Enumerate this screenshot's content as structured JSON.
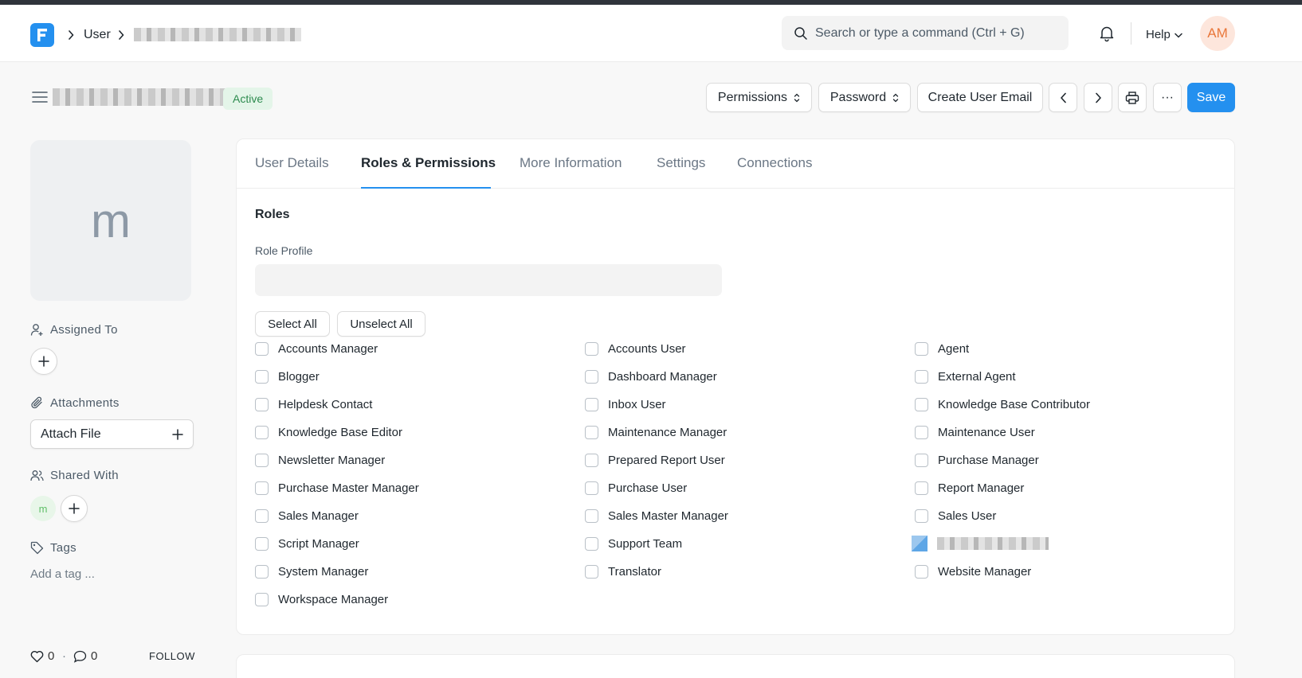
{
  "navbar": {
    "logo_letter": "F",
    "breadcrumb_doctype": "User",
    "search_placeholder": "Search or type a command (Ctrl + G)",
    "help_label": "Help",
    "user_initials": "AM"
  },
  "header": {
    "status": "Active",
    "buttons": {
      "permissions": "Permissions",
      "password": "Password",
      "create_user_email": "Create User Email",
      "more": "···",
      "save": "Save"
    }
  },
  "sidebar": {
    "avatar_letter": "m",
    "assigned_to": "Assigned To",
    "attachments": "Attachments",
    "attach_file": "Attach File",
    "shared_with": "Shared With",
    "shared_avatar": "m",
    "tags": "Tags",
    "add_tag": "Add a tag ...",
    "likes": "0",
    "comments": "0",
    "follow": "FOLLOW"
  },
  "tabs": [
    {
      "label": "User Details",
      "active": false
    },
    {
      "label": "Roles & Permissions",
      "active": true
    },
    {
      "label": "More Information",
      "active": false
    },
    {
      "label": "Settings",
      "active": false
    },
    {
      "label": "Connections",
      "active": false
    }
  ],
  "roles_section": {
    "title": "Roles",
    "role_profile_label": "Role Profile",
    "role_profile_value": "",
    "select_all": "Select All",
    "unselect_all": "Unselect All",
    "roles": [
      [
        "Accounts Manager",
        "Accounts User",
        "Agent"
      ],
      [
        "Blogger",
        "Dashboard Manager",
        "External Agent"
      ],
      [
        "Helpdesk Contact",
        "Inbox User",
        "Knowledge Base Contributor"
      ],
      [
        "Knowledge Base Editor",
        "Maintenance Manager",
        "Maintenance User"
      ],
      [
        "Newsletter Manager",
        "Prepared Report User",
        "Purchase Manager"
      ],
      [
        "Purchase Master Manager",
        "Purchase User",
        "Report Manager"
      ],
      [
        "Sales Manager",
        "Sales Master Manager",
        "Sales User"
      ],
      [
        "Script Manager",
        "Support Team",
        ""
      ],
      [
        "System Manager",
        "Translator",
        "Website Manager"
      ],
      [
        "Workspace Manager",
        "",
        ""
      ]
    ]
  },
  "colors": {
    "primary": "#2490ef",
    "active_badge_bg": "#e4f5e9",
    "active_badge_text": "#2d8b4e",
    "avatar_bg": "#fde6dc",
    "avatar_text": "#e9773a"
  }
}
